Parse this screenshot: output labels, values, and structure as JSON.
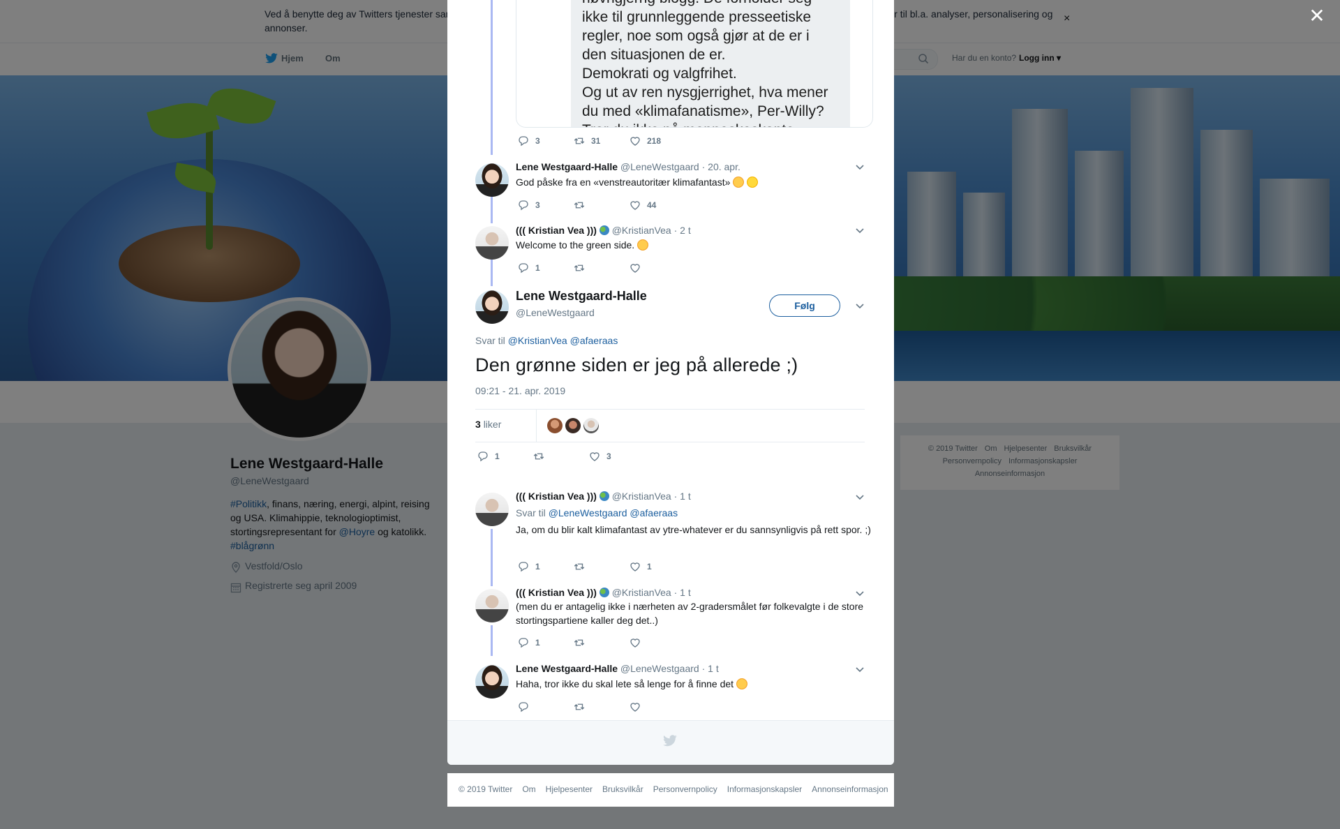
{
  "cookie_banner": {
    "text": "Ved å benytte deg av Twitters tjenester samtykker du i vår bruk av informasjonskapsler. Vi og våre samarbeidspartnere bruker informasjonskapsler til bl.a. analyser, personalisering og annonser.",
    "close_icon": "×"
  },
  "nav": {
    "home": "Hjem",
    "about": "Om",
    "login_question": "Har du en konto?",
    "login": "Logg inn"
  },
  "profile": {
    "name": "Lene Westgaard-Halle",
    "handle": "@LeneWestgaard",
    "bio_parts": [
      "#Politikk",
      ", finans, næring, energi, alpint, reising og USA. Klimahippie, teknologioptimist, stortingsrepresentant for ",
      "@Hoyre",
      " og katolikk. ",
      "#blågrønn"
    ],
    "location": "Vestfold/Oslo",
    "joined": "Registrerte seg april 2009"
  },
  "side_footer": {
    "links": [
      "© 2019 Twitter",
      "Om",
      "Hjelpesenter",
      "Bruksvilkår",
      "Personvernpolicy",
      "Informasjonskapsler",
      "Annonseinformasjon"
    ]
  },
  "quoted_image_text": "nøvngjerrig blogg. De forholder seg\nikke til grunnleggende presseetiske\nregler, noe som også gjør at de er i\nden situasjonen de er.\nDemokrati og valgfrihet.\nOg ut av ren nysgjerrighet, hva mener\ndu med «klimafanatisme», Per-Willy?\nTror du ikke på menneskeskapte",
  "thread_before": [
    {
      "actions": {
        "replies": "3",
        "retweets": "31",
        "likes": "218"
      }
    },
    {
      "name": "Lene Westgaard-Halle",
      "handle": "@LeneWestgaard",
      "time": "· 20. apr.",
      "text": "God påske fra en «venstreautoritær klimafantast»",
      "actions": {
        "replies": "3",
        "retweets": "",
        "likes": "44"
      }
    },
    {
      "name": "((( Kristian Vea )))",
      "handle": "@KristianVea",
      "time": "· 2 t",
      "text": "Welcome to the green side.",
      "actions": {
        "replies": "1",
        "retweets": "",
        "likes": ""
      }
    }
  ],
  "main_tweet": {
    "name": "Lene Westgaard-Halle",
    "handle": "@LeneWestgaard",
    "follow": "Følg",
    "reply_to_label": "Svar til",
    "reply_to_1": "@KristianVea",
    "reply_to_2": "@afaeraas",
    "text": "Den grønne siden er jeg på allerede ;)",
    "timestamp": "09:21 - 21. apr. 2019",
    "likes_count": "3",
    "likes_label": "liker",
    "actions": {
      "replies": "1",
      "retweets": "",
      "likes": "3"
    }
  },
  "replies": [
    {
      "name": "((( Kristian Vea )))",
      "handle": "@KristianVea",
      "time": "· 1 t",
      "reply_to_label": "Svar til",
      "reply_to_1": "@LeneWestgaard",
      "reply_to_2": "@afaeraas",
      "text": "Ja, om du blir kalt klimafantast av ytre-whatever er du sannsynligvis på rett spor. ;)",
      "actions": {
        "replies": "1",
        "retweets": "",
        "likes": "1"
      }
    },
    {
      "name": "((( Kristian Vea )))",
      "handle": "@KristianVea",
      "time": "· 1 t",
      "text": "(men du er antagelig ikke i nærheten av 2-gradersmålet før folkevalgte i de store stortingspartiene kaller deg det..)",
      "actions": {
        "replies": "1",
        "retweets": "",
        "likes": ""
      }
    },
    {
      "name": "Lene Westgaard-Halle",
      "handle": "@LeneWestgaard",
      "time": "· 1 t",
      "text": "Haha, tror ikke du skal lete så lenge for å finne det",
      "actions": {
        "replies": "",
        "retweets": "",
        "likes": ""
      }
    }
  ],
  "page_footer": {
    "links": [
      "© 2019 Twitter",
      "Om",
      "Hjelpesenter",
      "Bruksvilkår",
      "Personvernpolicy",
      "Informasjonskapsler",
      "Annonseinformasjon"
    ]
  },
  "colors": {
    "link": "#1b5e9e",
    "thread_line": "#aab8f2",
    "overlay": "rgba(0,0,0,0.5)"
  },
  "icons": [
    "close-icon",
    "twitter-bird-icon",
    "search-icon",
    "location-icon",
    "calendar-icon",
    "reply-icon",
    "retweet-icon",
    "heart-icon",
    "chevron-down-icon"
  ]
}
